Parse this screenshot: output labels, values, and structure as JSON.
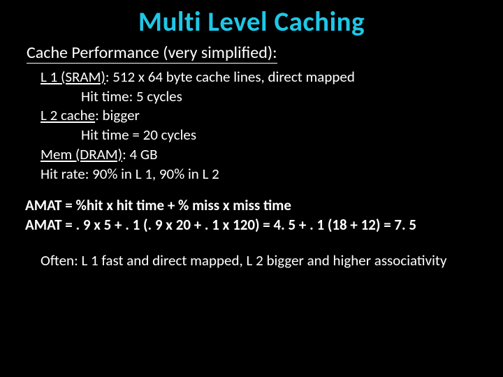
{
  "title": "Multi Level Caching",
  "subtitle": "Cache Performance (very simplified):",
  "specs": {
    "l1_label": "L 1 (SRAM)",
    "l1_rest": ": 512 x 64 byte cache lines, direct mapped",
    "l1_hit": "Hit time: 5 cycles",
    "l2_label": "L 2 cache",
    "l2_rest": ": bigger",
    "l2_hit": "Hit time = 20 cycles",
    "mem_label": "Mem (DRAM)",
    "mem_rest": ": 4 GB",
    "hitrate": "Hit rate: 90% in L 1, 90% in L 2"
  },
  "amat": {
    "formula": "AMAT = %hit x hit time + % miss x miss time",
    "calc": "AMAT = . 9 x 5 + . 1 (. 9 x 20 + . 1 x 120) = 4. 5 + . 1 (18 + 12) = 7. 5"
  },
  "footer": "Often: L 1 fast and direct mapped, L 2 bigger and higher associativity"
}
